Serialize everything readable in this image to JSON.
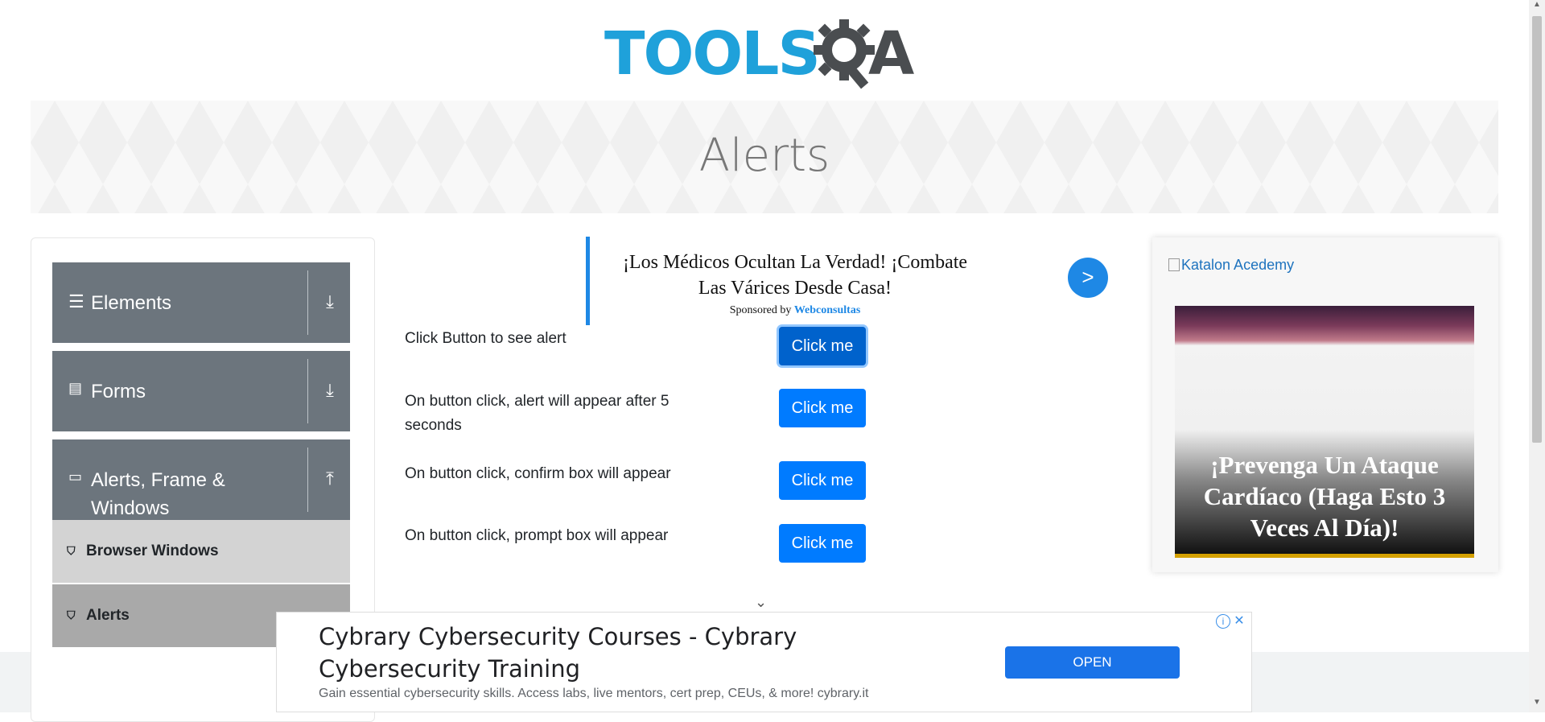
{
  "header": {
    "logo_tools": "TOOLS",
    "logo_a": "A"
  },
  "banner": {
    "title": "Alerts"
  },
  "sidebar": {
    "groups": [
      {
        "label": "Elements",
        "icon": "hamburger-icon",
        "arrow": "download-arrow-icon"
      },
      {
        "label": "Forms",
        "icon": "document-icon",
        "arrow": "download-arrow-icon"
      },
      {
        "label": "Alerts, Frame & Windows",
        "icon": "window-icon",
        "arrow": "upload-arrow-icon"
      }
    ],
    "items": [
      {
        "label": "Browser Windows",
        "active": false
      },
      {
        "label": "Alerts",
        "active": true
      }
    ]
  },
  "ad_top": {
    "headline": "¡Los Médicos Ocultan La Verdad! ¡Combate Las Várices Desde Casa!",
    "sponsored_by": "Sponsored by",
    "sponsor": "Webconsultas",
    "go_label": ">"
  },
  "alerts": {
    "rows": [
      {
        "label": "Click Button to see alert",
        "button": "Click me"
      },
      {
        "label": "On button click, alert will appear after 5 seconds",
        "button": "Click me"
      },
      {
        "label": "On button click, confirm box will appear",
        "button": "Click me"
      },
      {
        "label": "On button click, prompt box will appear",
        "button": "Click me"
      }
    ]
  },
  "ad_right": {
    "image_alt": "Katalon Acedemy",
    "headline": "¡Prevenga Un Ataque Cardíaco (Haga Esto 3 Veces Al Día)!"
  },
  "ad_bottom": {
    "title": "Cybrary Cybersecurity Courses - Cybrary Cybersecurity Training",
    "description": "Gain essential cybersecurity skills. Access labs, live mentors, cert prep, CEUs, & more! cybrary.it",
    "button": "OPEN"
  },
  "colors": {
    "brand_blue": "#1fa1da",
    "button_blue": "#007bff",
    "sidebar_grey": "#6c757d"
  }
}
